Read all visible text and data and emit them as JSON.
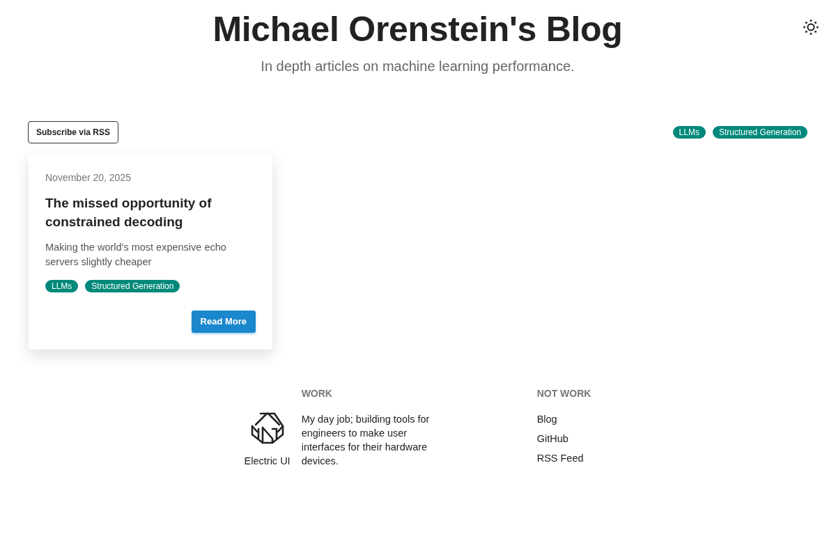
{
  "header": {
    "title": "Michael Orenstein's Blog",
    "subtitle": "In depth articles on machine learning performance."
  },
  "subscribe_button": "Subscribe via RSS",
  "tag_filters": [
    {
      "label": "LLMs"
    },
    {
      "label": "Structured Generation"
    }
  ],
  "posts": [
    {
      "date": "November 20, 2025",
      "title": "The missed opportunity of constrained decoding",
      "summary": "Making the world's most expensive echo servers slightly cheaper",
      "tags": [
        "LLMs",
        "Structured Generation"
      ],
      "button": "Read More"
    }
  ],
  "footer": {
    "work": {
      "heading": "WORK",
      "logo_label": "Electric UI",
      "description": "My day job; building tools for engineers to make user interfaces for their hardware devices."
    },
    "not_work": {
      "heading": "NOT WORK",
      "links": [
        "Blog",
        "GitHub",
        "RSS Feed"
      ]
    }
  }
}
